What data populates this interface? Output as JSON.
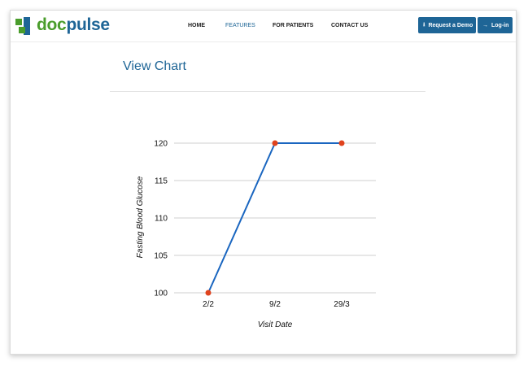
{
  "brand": {
    "name_part1": "doc",
    "name_part2": "pulse",
    "color1": "#4a9d2c",
    "color2": "#1e6596"
  },
  "nav": {
    "items": [
      {
        "label": "HOME",
        "active": false
      },
      {
        "label": "FEATURES",
        "active": true
      },
      {
        "label": "FOR PATIENTS",
        "active": false
      },
      {
        "label": "CONTACT US",
        "active": false
      }
    ],
    "active_color": "#1e6596"
  },
  "buttons": {
    "demo": {
      "label": "Request a Demo",
      "icon": "download-icon"
    },
    "login": {
      "label": "Log-in",
      "icon": "sign-in-icon"
    }
  },
  "page": {
    "title": "View Chart"
  },
  "chart_data": {
    "type": "line",
    "categories": [
      "2/2",
      "9/2",
      "29/3"
    ],
    "values": [
      100,
      120,
      120
    ],
    "xlabel": "Visit Date",
    "ylabel": "Fasting Blood Glucose",
    "ylim": [
      100,
      120
    ],
    "yticks": [
      100,
      105,
      110,
      115,
      120
    ],
    "grid": true,
    "line_color": "#1a66c0",
    "marker_color": "#e0431d"
  }
}
